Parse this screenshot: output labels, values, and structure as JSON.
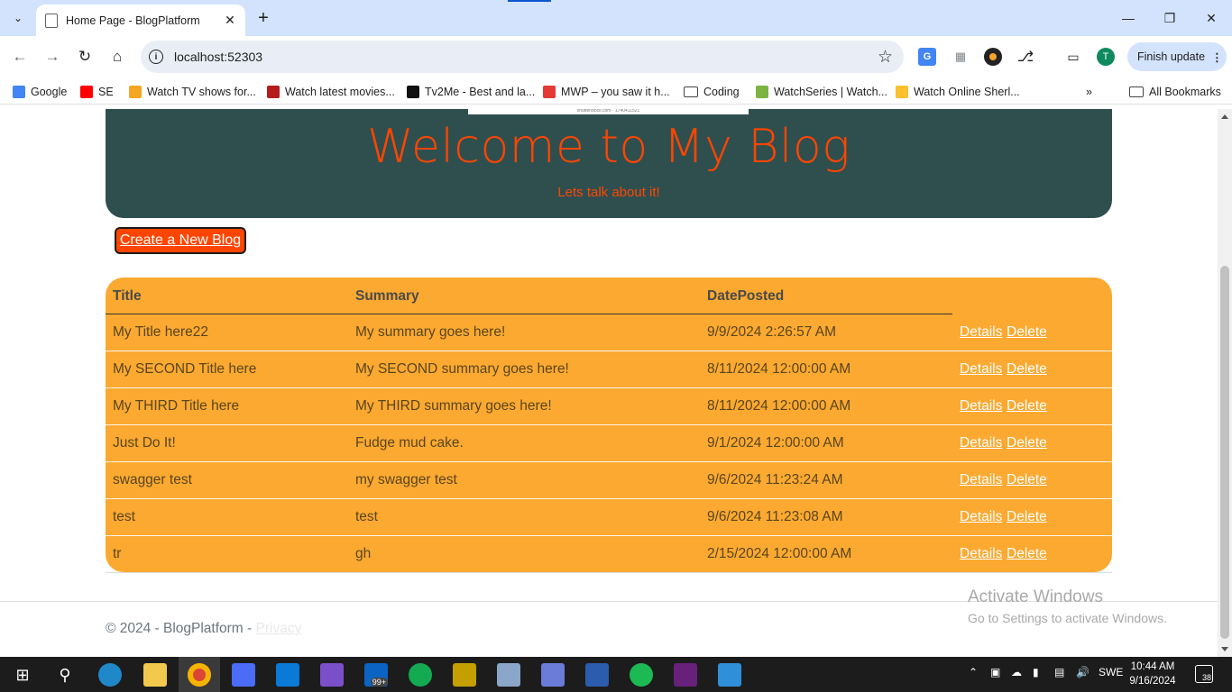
{
  "browser": {
    "tab_title": "Home Page - BlogPlatform",
    "url": "localhost:52303",
    "profile_initial": "T",
    "finish_update_label": "Finish update",
    "bookmarks": [
      {
        "label": "Google",
        "icon": "google-icon",
        "color": "#4285f4"
      },
      {
        "label": "SE",
        "icon": "youtube-icon",
        "color": "#ff0000"
      },
      {
        "label": "Watch TV shows for...",
        "icon": "tv-icon",
        "color": "#f5a623"
      },
      {
        "label": "Watch latest movies...",
        "icon": "movie-icon",
        "color": "#b71c1c"
      },
      {
        "label": "Tv2Me - Best and la...",
        "icon": "tv2me-icon",
        "color": "#111111"
      },
      {
        "label": "MWP – you saw it h...",
        "icon": "mwp-icon",
        "color": "#e53935"
      },
      {
        "label": "Coding",
        "icon": "folder-icon",
        "color": "#444444"
      },
      {
        "label": "WatchSeries | Watch...",
        "icon": "watchseries-icon",
        "color": "#7cb342"
      },
      {
        "label": "Watch Online Sherl...",
        "icon": "emoji-icon",
        "color": "#fbc02d"
      }
    ],
    "all_bookmarks_label": "All Bookmarks"
  },
  "hero": {
    "image_caption": "shutterstock.com · 1740411521",
    "title": "Welcome to My Blog",
    "subtitle": "Lets talk about it!"
  },
  "create_button_label": "Create a New Blog",
  "table": {
    "headers": {
      "title": "Title",
      "summary": "Summary",
      "date": "DatePosted"
    },
    "details_label": "Details",
    "delete_label": "Delete",
    "rows": [
      {
        "title": "My Title here22",
        "summary": "My summary goes here!",
        "date": "9/9/2024 2:26:57 AM"
      },
      {
        "title": "My SECOND Title here",
        "summary": "My SECOND summary goes here!",
        "date": "8/11/2024 12:00:00 AM"
      },
      {
        "title": "My THIRD Title here",
        "summary": "My THIRD summary goes here!",
        "date": "8/11/2024 12:00:00 AM"
      },
      {
        "title": "Just Do It!",
        "summary": "Fudge mud cake.",
        "date": "9/1/2024 12:00:00 AM"
      },
      {
        "title": "swagger test",
        "summary": "my swagger test",
        "date": "9/6/2024 11:23:24 AM"
      },
      {
        "title": "test",
        "summary": "test",
        "date": "9/6/2024 11:23:08 AM"
      },
      {
        "title": "tr",
        "summary": "gh",
        "date": "2/15/2024 12:00:00 AM"
      }
    ]
  },
  "footer": {
    "copyright": "© 2024 - BlogPlatform - ",
    "privacy": "Privacy"
  },
  "watermark": {
    "line1": "Activate Windows",
    "line2": "Go to Settings to activate Windows."
  },
  "taskbar": {
    "language": "SWE",
    "time": "10:44 AM",
    "date": "9/16/2024",
    "notification_count": "38",
    "mail_badge": "99+"
  },
  "colors": {
    "hero_bg": "#2f4f4f",
    "accent": "#ff4500",
    "table_bg": "#fba930"
  }
}
